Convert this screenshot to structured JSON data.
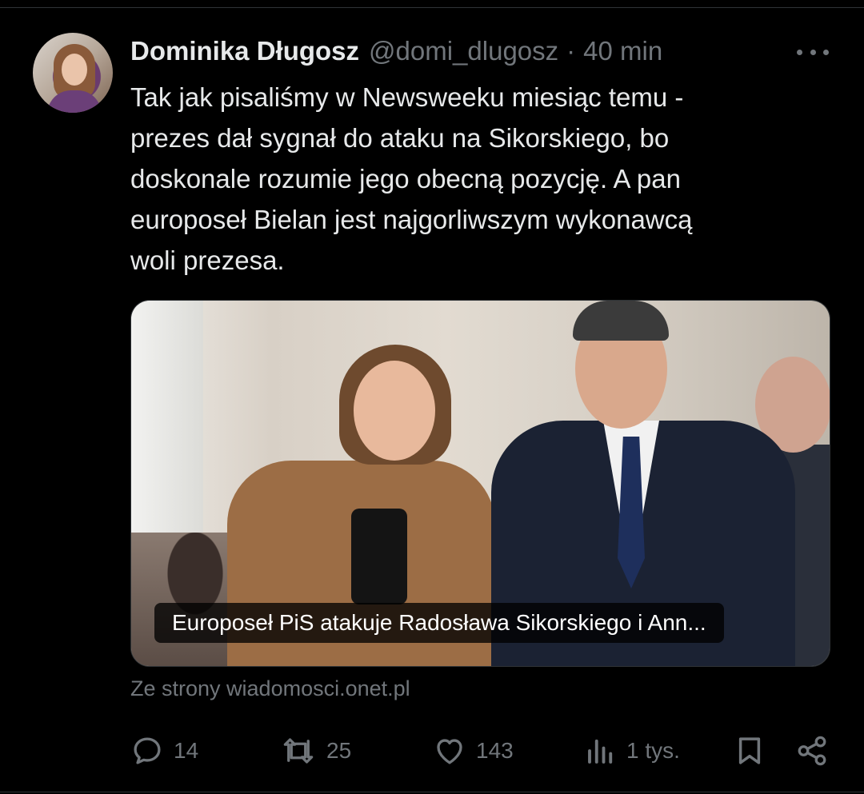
{
  "author": {
    "name": "Dominika Długosz",
    "handle": "@domi_dlugosz",
    "separator": "·",
    "time": "40 min"
  },
  "tweet": {
    "text": "Tak jak pisaliśmy w Newsweeku miesiąc temu -\nprezes dał sygnał do ataku na Sikorskiego, bo\ndoskonale rozumie jego obecną pozycję. A pan\neuroposeł Bielan jest najgorliwszym wykonawcą\nwoli prezesa."
  },
  "card": {
    "caption": "Europoseł PiS atakuje Radosława Sikorskiego i Ann...",
    "source": "Ze strony wiadomosci.onet.pl"
  },
  "actions": {
    "replies": "14",
    "reposts": "25",
    "likes": "143",
    "views": "1 tys."
  },
  "icons": {
    "more": "more-horizontal-icon",
    "reply": "reply-icon",
    "repost": "repost-icon",
    "like": "heart-icon",
    "views": "views-icon",
    "bookmark": "bookmark-icon",
    "share": "share-icon"
  },
  "colors": {
    "background": "#000000",
    "text": "#e7e9ea",
    "muted": "#71767b"
  }
}
